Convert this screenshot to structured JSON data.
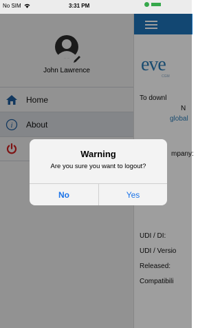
{
  "status_bar": {
    "carrier": "No SIM",
    "time": "3:31 PM"
  },
  "drawer": {
    "user_name": "John Lawrence",
    "items": [
      {
        "label": "Home",
        "icon": "home-icon"
      },
      {
        "label": "About",
        "icon": "info-icon"
      },
      {
        "label": "",
        "icon": "power-icon"
      }
    ]
  },
  "main": {
    "logo_text": "eve",
    "logo_sub": "CGM",
    "line1": "To downl",
    "line2": "N",
    "link": "global",
    "company": "mpany:",
    "udi_di": "UDI / DI:",
    "udi_version": "UDI / Versio",
    "released": "Released:",
    "compat": "Compatibili"
  },
  "alert": {
    "title": "Warning",
    "message": "Are you sure you want to logout?",
    "no_label": "No",
    "yes_label": "Yes"
  },
  "colors": {
    "nav_blue": "#1e73b8",
    "link_blue": "#1a73e8",
    "logout_red": "#cc1f1f"
  }
}
